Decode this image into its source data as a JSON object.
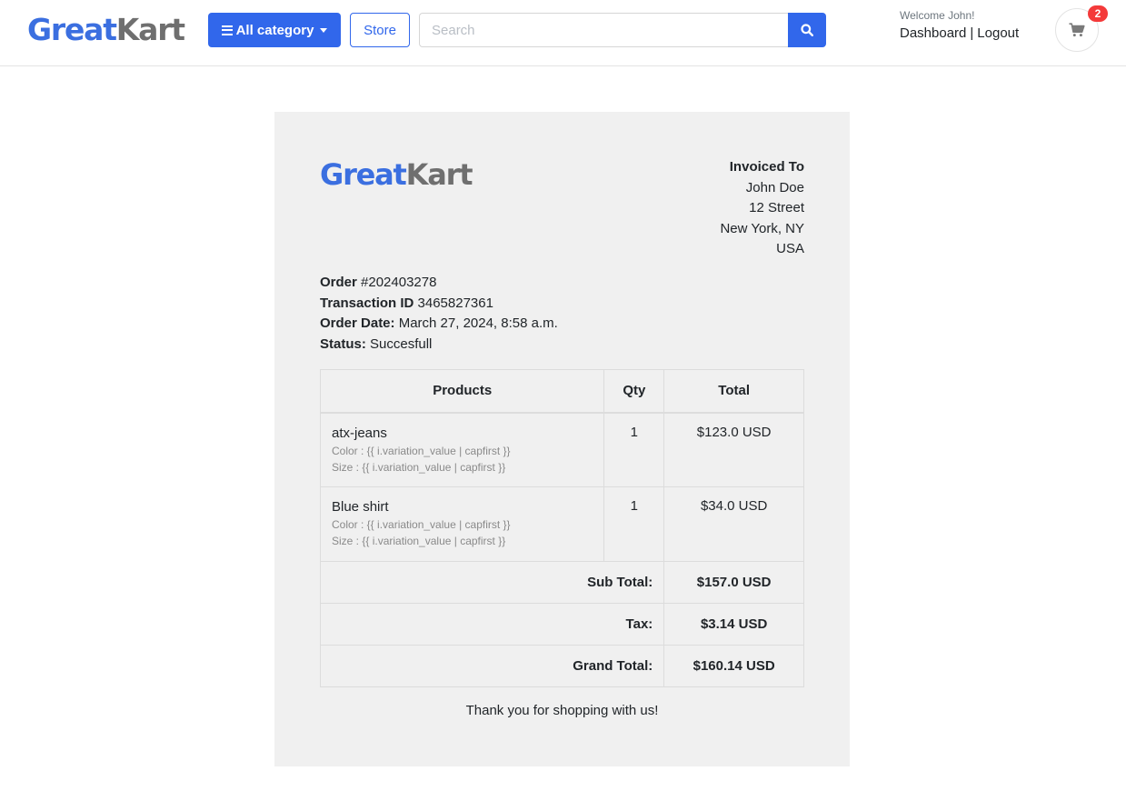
{
  "header": {
    "logo_part1": "Great",
    "logo_part2": "Kart",
    "category_label": "All category",
    "store_label": "Store",
    "search_placeholder": "Search",
    "welcome": "Welcome John!",
    "dashboard_label": "Dashboard",
    "separator": "|",
    "logout_label": "Logout",
    "cart_count": "2",
    "colors": {
      "primary": "#3167eb",
      "badge": "#f43a3a"
    },
    "icons": [
      "bars-icon",
      "caret-down-icon",
      "search-icon",
      "cart-icon"
    ]
  },
  "invoice": {
    "logo_part1": "Great",
    "logo_part2": "Kart",
    "invoiced_to_title": "Invoiced To",
    "address": [
      "John Doe",
      "12 Street",
      "New York, NY",
      "USA"
    ],
    "order_label": "Order",
    "order_number": "#202403278",
    "transaction_label": "Transaction ID",
    "transaction_id": "3465827361",
    "order_date_label": "Order Date:",
    "order_date": "March 27, 2024, 8:58 a.m.",
    "status_label": "Status:",
    "status": "Succesfull",
    "table": {
      "headers": [
        "Products",
        "Qty",
        "Total"
      ],
      "rows": [
        {
          "name": "atx-jeans",
          "color": "Color : {{ i.variation_value | capfirst }}",
          "size": "Size : {{ i.variation_value | capfirst }}",
          "qty": "1",
          "total": "$123.0 USD"
        },
        {
          "name": "Blue shirt",
          "color": "Color : {{ i.variation_value | capfirst }}",
          "size": "Size : {{ i.variation_value | capfirst }}",
          "qty": "1",
          "total": "$34.0 USD"
        }
      ],
      "subtotal_label": "Sub Total:",
      "subtotal": "$157.0 USD",
      "tax_label": "Tax:",
      "tax": "$3.14 USD",
      "grand_label": "Grand Total:",
      "grand_total": "$160.14 USD"
    },
    "thanks": "Thank you for shopping with us!"
  }
}
